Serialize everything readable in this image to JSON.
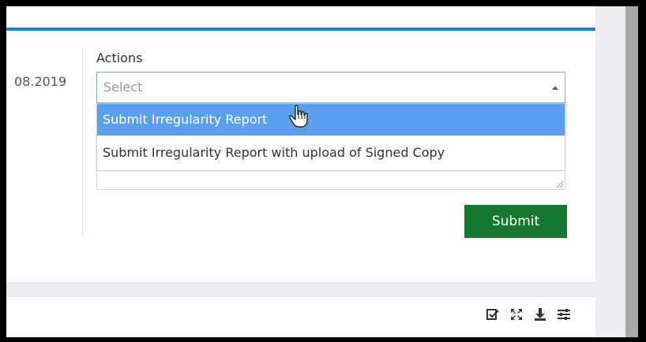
{
  "form": {
    "date_fragment": "08.2019",
    "actions_label": "Actions",
    "select_placeholder": "Select",
    "options": [
      "Submit Irregularity Report",
      "Submit Irregularity Report with upload of Signed Copy"
    ],
    "selected_index": 0,
    "submit_label": "Submit"
  },
  "toolbar": {
    "icons": [
      "edit-check-icon",
      "expand-icon",
      "download-icon",
      "filter-settings-icon"
    ]
  },
  "colors": {
    "accent": "#1f7fe0",
    "option_highlight": "#5a9ef0",
    "submit_green": "#157a2e"
  }
}
